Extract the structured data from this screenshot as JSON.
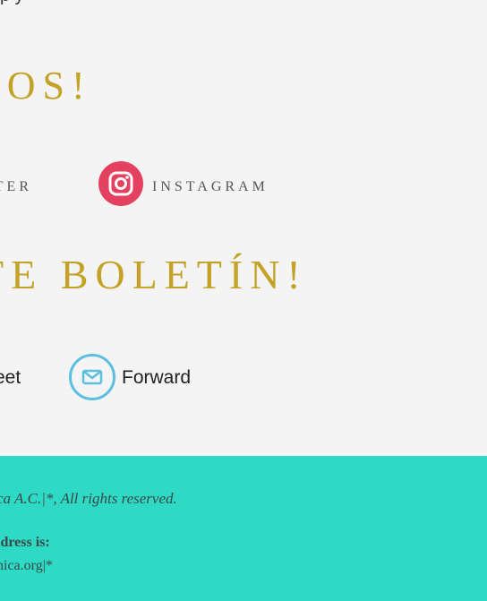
{
  "top_fragment": "p                    y",
  "follow": {
    "heading": "NOS!"
  },
  "social": {
    "twitter_label": "TTER",
    "instagram_label": "INSTAGRAM",
    "instagram_icon": "instagram-icon"
  },
  "share": {
    "heading": "TE BOLETÍN!",
    "tweet_label": "eet",
    "forward_label": "Forward",
    "forward_icon": "envelope-icon"
  },
  "footer": {
    "copyright": "ca A.C.|*, All rights reserved.",
    "address_title": "ldress is:",
    "address_email": "nica.org|*"
  },
  "colors": {
    "background": "#f4f4f4",
    "heading_gold": "#c4a227",
    "instagram": "#e4405f",
    "forward_ring": "#5bbfe0",
    "footer": "#2ed9c5"
  }
}
